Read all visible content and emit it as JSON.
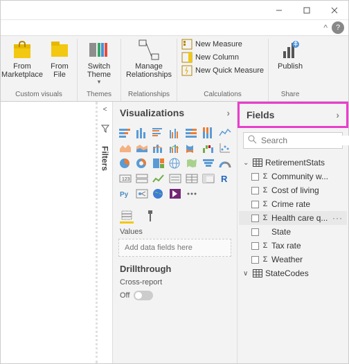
{
  "window": {
    "minimize": "min",
    "maximize": "max",
    "close": "close"
  },
  "ribbon": {
    "custom_visuals": {
      "label": "Custom visuals",
      "from_marketplace": "From Marketplace",
      "from_file": "From File"
    },
    "themes": {
      "label": "Themes",
      "switch_theme": "Switch Theme"
    },
    "relationships": {
      "label": "Relationships",
      "manage": "Manage Relationships"
    },
    "calculations": {
      "label": "Calculations",
      "new_measure": "New Measure",
      "new_column": "New Column",
      "new_quick_measure": "New Quick Measure"
    },
    "share": {
      "label": "Share",
      "publish": "Publish"
    }
  },
  "filters": {
    "label": "Filters"
  },
  "viz": {
    "header": "Visualizations",
    "tabs": {
      "values": "Values"
    },
    "drop_hint": "Add data fields here",
    "drillthrough": "Drillthrough",
    "cross_report": "Cross-report",
    "off": "Off"
  },
  "fields": {
    "header": "Fields",
    "search_placeholder": "Search",
    "tables": [
      {
        "name": "RetirementStats",
        "expanded": true,
        "cols": [
          {
            "name": "Community w...",
            "sigma": true
          },
          {
            "name": "Cost of living",
            "sigma": true
          },
          {
            "name": "Crime rate",
            "sigma": true
          },
          {
            "name": "Health care q...",
            "sigma": true,
            "hl": true,
            "more": true
          },
          {
            "name": "State",
            "sigma": false
          },
          {
            "name": "Tax rate",
            "sigma": true
          },
          {
            "name": "Weather",
            "sigma": true
          }
        ]
      },
      {
        "name": "StateCodes",
        "expanded": false,
        "cols": []
      }
    ]
  }
}
